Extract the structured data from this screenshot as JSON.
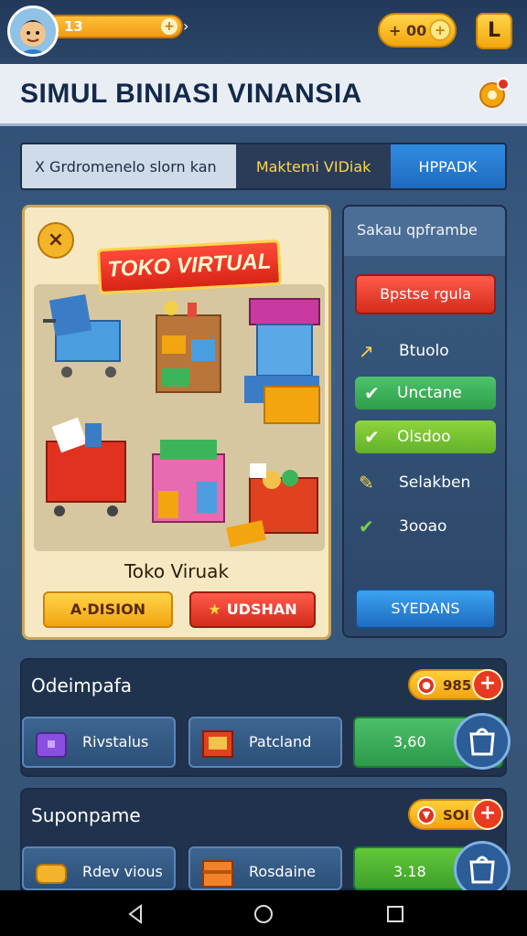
{
  "top": {
    "level": "13",
    "coins": "+ 00"
  },
  "title": "SIMUL BINIASI VINANSIA",
  "tabs": [
    {
      "label": "X Grdromenelo slorn kan"
    },
    {
      "label": "Maktemi VIDiak"
    },
    {
      "label": "HPPADK"
    }
  ],
  "store": {
    "banner": "TOKO VIRTUAL",
    "name": "Toko Viruak",
    "btn_primary": "A·DISION",
    "btn_secondary": "UDSHAN"
  },
  "side": {
    "header": "Sakau qpframbe",
    "red_button": "Bpstse rgula",
    "options": [
      {
        "label": "Btuolo",
        "style": "plain",
        "icon": "arrow-icon"
      },
      {
        "label": "Unctane",
        "style": "green",
        "icon": "check-icon"
      },
      {
        "label": "Olsdoo",
        "style": "lime",
        "icon": "check-icon"
      },
      {
        "label": "Selakben",
        "style": "plain",
        "icon": "pencil-check-icon"
      },
      {
        "label": "3ooao",
        "style": "plain",
        "icon": "check-icon"
      }
    ],
    "blue_button": "SYEDANS"
  },
  "sections": [
    {
      "title": "Odeimpafa",
      "pill_value": "985",
      "cards": [
        {
          "label": "Rivstalus"
        },
        {
          "label": "Patcland"
        }
      ],
      "price": "3,60"
    },
    {
      "title": "Suponpame",
      "pill_value": "SOI",
      "cards": [
        {
          "label": "Rdev vious"
        },
        {
          "label": "Rosdaine"
        }
      ],
      "price": "3.18"
    }
  ],
  "colors": {
    "accent_yellow": "#f2a50f",
    "accent_red": "#d52c1c",
    "accent_blue": "#1f6bc0",
    "accent_green": "#2e9e4a"
  }
}
